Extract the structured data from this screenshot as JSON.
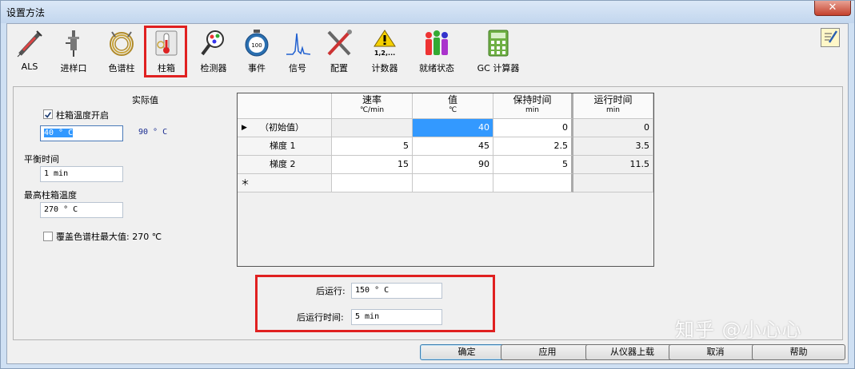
{
  "window": {
    "title": "设置方法",
    "close_glyph": "✕"
  },
  "toolbar": {
    "items": [
      {
        "label": "ALS",
        "icon": "syringe-icon"
      },
      {
        "label": "进样口",
        "icon": "inlet-icon"
      },
      {
        "label": "色谱柱",
        "icon": "column-coil-icon"
      },
      {
        "label": "柱箱",
        "icon": "oven-thermometer-icon",
        "selected": true
      },
      {
        "label": "检测器",
        "icon": "detector-magnifier-icon"
      },
      {
        "label": "事件",
        "icon": "stopwatch-icon"
      },
      {
        "label": "信号",
        "icon": "signal-peak-icon"
      },
      {
        "label": "配置",
        "icon": "tools-icon"
      },
      {
        "label": "计数器",
        "icon": "counter-warning-icon",
        "icon_text": "1,2,..."
      },
      {
        "label": "就绪状态",
        "icon": "people-status-icon"
      },
      {
        "label": "GC 计算器",
        "icon": "calculator-icon"
      }
    ],
    "notes_icon": "edit-notes-icon"
  },
  "oven": {
    "actual_label": "实际值",
    "temp_on_label": "柱箱温度开启",
    "temp_on_checked": true,
    "setpoint": "40 ° C",
    "actual_value": "90 ° C",
    "equil_label": "平衡时间",
    "equil_value": "1 min",
    "max_label": "最高柱箱温度",
    "max_value": "270 ° C",
    "override_label": "覆盖色谱柱最大值: 270 ℃",
    "override_checked": false
  },
  "program_table": {
    "headers": [
      {
        "title": "速率",
        "unit": "℃/min"
      },
      {
        "title": "值",
        "unit": "℃"
      },
      {
        "title": "保持时间",
        "unit": "min"
      },
      {
        "title": "运行时间",
        "unit": "min"
      }
    ],
    "rows": [
      {
        "name": "（初始值）",
        "rate": "",
        "value": "40",
        "hold": "0",
        "run": "0",
        "current": true
      },
      {
        "name": "梯度 1",
        "rate": "5",
        "value": "45",
        "hold": "2.5",
        "run": "3.5"
      },
      {
        "name": "梯度 2",
        "rate": "15",
        "value": "90",
        "hold": "5",
        "run": "11.5"
      }
    ],
    "current_marker": "▶",
    "new_row_marker": "＊"
  },
  "post_run": {
    "temp_label": "后运行:",
    "temp_value": "150 ° C",
    "time_label": "后运行时间:",
    "time_value": "5 min"
  },
  "buttons": {
    "ok": "确定",
    "apply": "应用",
    "upload": "从仪器上载",
    "cancel": "取消",
    "help": "帮助"
  },
  "watermark": "知乎 @小心心"
}
